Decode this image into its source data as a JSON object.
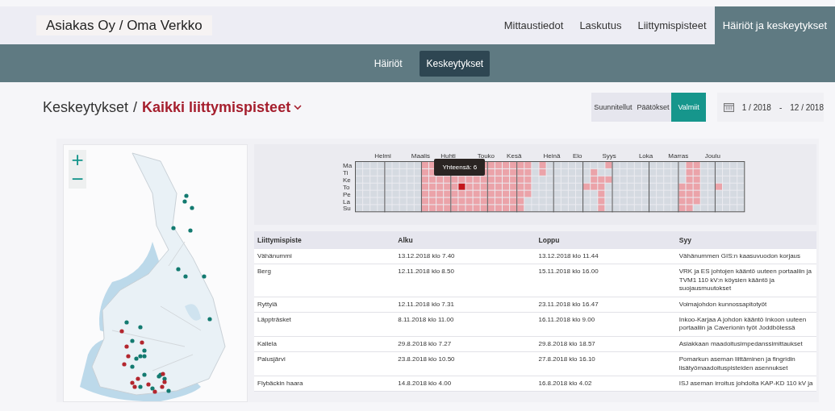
{
  "header": {
    "title": "Asiakas Oy / Oma Verkko",
    "tabs": [
      {
        "label": "Mittaustiedot",
        "selected": false
      },
      {
        "label": "Laskutus",
        "selected": false
      },
      {
        "label": "Liittymispisteet",
        "selected": false
      },
      {
        "label": "Häiriöt ja keskeytykset",
        "selected": true
      }
    ]
  },
  "subtabs": [
    {
      "label": "Häiriöt",
      "selected": false
    },
    {
      "label": "Keskeytykset",
      "selected": true
    }
  ],
  "page": {
    "title": "Keskeytykset",
    "separator": "/",
    "scope": "Kaikki liittymispisteet",
    "filters": [
      {
        "label": "Suunnitellut",
        "selected": false
      },
      {
        "label": "Päätökset",
        "selected": false
      },
      {
        "label": "Valmiit",
        "selected": true
      }
    ],
    "date_range": {
      "from": "1 / 2018",
      "dash": "-",
      "to": "12 / 2018"
    }
  },
  "map": {
    "zoom_in": "+",
    "zoom_out": "−"
  },
  "heatmap": {
    "months": [
      "Helmi",
      "Maalis",
      "Huhti",
      "Touko",
      "Kesä",
      "Heinä",
      "Elo",
      "Syys",
      "Loka",
      "Marras",
      "Joulu"
    ],
    "days": [
      "Ma",
      "Ti",
      "Ke",
      "To",
      "Pe",
      "La",
      "Su"
    ],
    "tooltip": "Yhteensä: 6"
  },
  "table": {
    "columns": [
      "Liittymispiste",
      "Alku",
      "Loppu",
      "Syy"
    ],
    "rows": [
      [
        "Vähänummi",
        "13.12.2018 klo 7.40",
        "13.12.2018 klo 11.44",
        "Vähänummen GIS:n kaasuvuodon korjaus"
      ],
      [
        "Berg",
        "12.11.2018 klo 8.50",
        "15.11.2018 klo 16.00",
        "VRK ja ES johtojen kääntö uuteen portaaliin ja TVM1 110 kV:n köysien kääntö ja suojausmuutokset"
      ],
      [
        "Ryttylä",
        "12.11.2018 klo 7.31",
        "23.11.2018 klo 16.47",
        "Voimajohdon kunnossapitotyöt"
      ],
      [
        "Läppträsket",
        "8.11.2018 klo 11.00",
        "16.11.2018 klo 9.00",
        "Inkoo-Karjaa A johdon kääntö Inkoon uuteen portaaliin ja Caverionin työt Joddbölessä"
      ],
      [
        "Kallela",
        "29.8.2018 klo 7.27",
        "29.8.2018 klo 18.57",
        "Asiakkaan maadoitusimpedanssimittaukset"
      ],
      [
        "Palusjärvi",
        "23.8.2018 klo 10.50",
        "27.8.2018 klo 16.10",
        "Pomarkun aseman liittäminen ja fingridin lisätyömaadoituspisteiden asennukset"
      ],
      [
        "Flybäckin haara",
        "14.8.2018 klo 4.00",
        "16.8.2018 klo 4.02",
        "ISJ aseman irroitus johdolta KAP-KD 110 kV ja"
      ]
    ]
  }
}
